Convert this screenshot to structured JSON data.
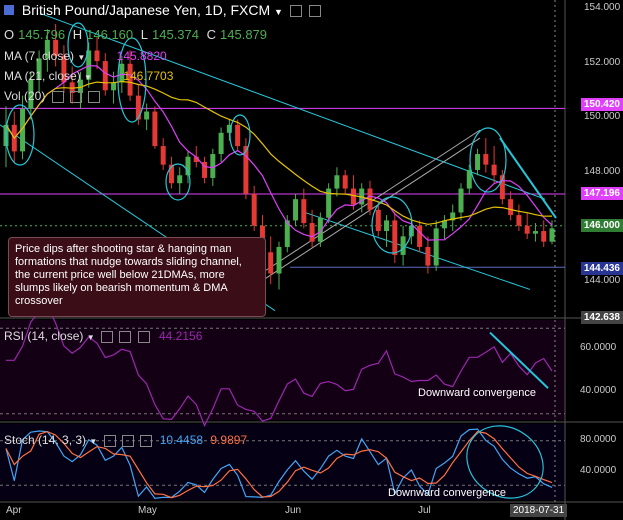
{
  "header": {
    "title": "British Pound/Japanese Yen, 1D, FXCM",
    "open_label": "O",
    "open": "145.796",
    "high_label": "H",
    "high": "146.160",
    "low_label": "L",
    "low": "145.374",
    "close_label": "C",
    "close": "145.879"
  },
  "indicators": {
    "ma7_label": "MA (7, close)",
    "ma7_value": "145.8820",
    "ma21_label": "MA (21, close)",
    "ma21_value": "146.7703",
    "vol_label": "Vol (20)"
  },
  "price_axis": {
    "ticks": [
      "154.000",
      "152.000",
      "150.000",
      "148.000",
      "146.000",
      "144.000"
    ],
    "tag_upper": "150.420",
    "tag_mid": "147.196",
    "tag_current": "146.000",
    "tag_lower": "144.436",
    "tag_bottom": "142.638"
  },
  "annotation": {
    "text": "Price dips after shooting star & hanging man formations that nudge towards sliding channel, the current price well below 21DMAs, more slumps likely on bearish momentum & DMA crossover"
  },
  "rsi": {
    "label": "RSI (14, close)",
    "value": "44.2156",
    "ticks": [
      "60.0000",
      "40.0000"
    ],
    "note": "Downward convergence"
  },
  "stoch": {
    "label": "Stoch (14, 3, 3)",
    "k_value": "10.4458",
    "d_value": "9.9897",
    "ticks": [
      "80.0000",
      "40.0000"
    ],
    "note": "Downward convergence"
  },
  "time_axis": {
    "labels": [
      "Apr",
      "May",
      "Jun",
      "Jul"
    ],
    "date_badge": "2018-07-31"
  },
  "colors": {
    "bull": "#4caf50",
    "bear": "#e53935",
    "ma7": "#e040fb",
    "ma21": "#e6c200",
    "channel": "#26c6da",
    "resistance": "#e040fb",
    "support": "#5c6bc0"
  },
  "chart_data": {
    "type": "candlestick",
    "series": [
      {
        "name": "MA (7, close)"
      },
      {
        "name": "MA (21, close)"
      }
    ],
    "ohlc": [
      [
        149.0,
        150.5,
        148.2,
        149.8
      ],
      [
        149.8,
        150.3,
        148.4,
        148.8
      ],
      [
        148.8,
        150.9,
        148.5,
        150.4
      ],
      [
        150.4,
        151.8,
        150.0,
        151.5
      ],
      [
        151.5,
        152.6,
        151.0,
        152.3
      ],
      [
        152.3,
        153.4,
        151.8,
        153.0
      ],
      [
        153.0,
        153.6,
        152.0,
        152.4
      ],
      [
        152.4,
        152.8,
        151.0,
        151.4
      ],
      [
        151.4,
        152.0,
        150.6,
        151.0
      ],
      [
        151.0,
        151.8,
        150.4,
        151.5
      ],
      [
        151.5,
        152.9,
        151.2,
        152.6
      ],
      [
        152.6,
        153.1,
        151.9,
        152.2
      ],
      [
        152.2,
        152.5,
        150.9,
        151.1
      ],
      [
        151.1,
        151.8,
        150.6,
        151.4
      ],
      [
        151.4,
        152.4,
        151.0,
        152.1
      ],
      [
        152.1,
        152.6,
        150.7,
        150.9
      ],
      [
        150.9,
        151.3,
        149.8,
        150.0
      ],
      [
        150.0,
        150.6,
        149.6,
        150.3
      ],
      [
        150.3,
        150.5,
        148.9,
        149.0
      ],
      [
        149.0,
        149.3,
        148.1,
        148.3
      ],
      [
        148.3,
        148.6,
        147.4,
        147.6
      ],
      [
        147.6,
        148.2,
        147.2,
        147.9
      ],
      [
        147.9,
        148.8,
        147.6,
        148.6
      ],
      [
        148.6,
        149.0,
        148.2,
        148.4
      ],
      [
        148.4,
        148.6,
        147.6,
        147.8
      ],
      [
        147.8,
        148.9,
        147.5,
        148.7
      ],
      [
        148.7,
        149.7,
        148.4,
        149.5
      ],
      [
        149.5,
        150.0,
        149.2,
        149.8
      ],
      [
        149.8,
        150.0,
        148.8,
        149.0
      ],
      [
        149.0,
        149.3,
        147.0,
        147.2
      ],
      [
        147.2,
        147.5,
        145.8,
        146.0
      ],
      [
        146.0,
        146.4,
        144.8,
        145.0
      ],
      [
        145.0,
        145.6,
        143.8,
        144.2
      ],
      [
        144.2,
        145.4,
        143.6,
        145.2
      ],
      [
        145.2,
        146.4,
        145.0,
        146.2
      ],
      [
        146.2,
        147.2,
        146.0,
        147.0
      ],
      [
        147.0,
        147.4,
        145.9,
        146.1
      ],
      [
        146.1,
        146.6,
        145.2,
        145.4
      ],
      [
        145.4,
        146.5,
        145.2,
        146.3
      ],
      [
        146.3,
        147.6,
        146.1,
        147.4
      ],
      [
        147.4,
        148.2,
        147.1,
        147.9
      ],
      [
        147.9,
        148.1,
        147.2,
        147.4
      ],
      [
        147.4,
        147.9,
        146.6,
        146.8
      ],
      [
        146.8,
        147.6,
        146.5,
        147.4
      ],
      [
        147.4,
        147.7,
        146.4,
        146.6
      ],
      [
        146.6,
        146.9,
        145.6,
        145.8
      ],
      [
        145.8,
        146.4,
        145.2,
        146.2
      ],
      [
        146.2,
        146.5,
        144.6,
        144.9
      ],
      [
        144.9,
        146.0,
        144.5,
        145.6
      ],
      [
        145.6,
        146.3,
        145.3,
        146.0
      ],
      [
        146.0,
        146.2,
        145.0,
        145.2
      ],
      [
        145.2,
        145.6,
        144.2,
        144.5
      ],
      [
        144.5,
        146.2,
        144.3,
        145.9
      ],
      [
        145.9,
        146.4,
        145.5,
        146.2
      ],
      [
        146.2,
        146.8,
        145.8,
        146.5
      ],
      [
        146.5,
        147.6,
        146.2,
        147.4
      ],
      [
        147.4,
        148.3,
        147.2,
        148.1
      ],
      [
        148.1,
        148.9,
        147.9,
        148.7
      ],
      [
        148.7,
        149.3,
        148.0,
        148.3
      ],
      [
        148.3,
        149.0,
        147.6,
        147.9
      ],
      [
        147.9,
        148.1,
        146.8,
        147.0
      ],
      [
        147.0,
        147.3,
        146.2,
        146.4
      ],
      [
        146.4,
        146.8,
        145.8,
        146.0
      ],
      [
        146.0,
        146.5,
        145.5,
        145.7
      ],
      [
        145.7,
        146.1,
        145.4,
        145.8
      ],
      [
        145.8,
        146.2,
        145.2,
        145.4
      ],
      [
        145.4,
        146.2,
        145.3,
        145.9
      ]
    ],
    "price_range": [
      142.6,
      154.2
    ],
    "rsi_range": [
      28,
      72
    ],
    "stoch_range": [
      0,
      100
    ]
  }
}
